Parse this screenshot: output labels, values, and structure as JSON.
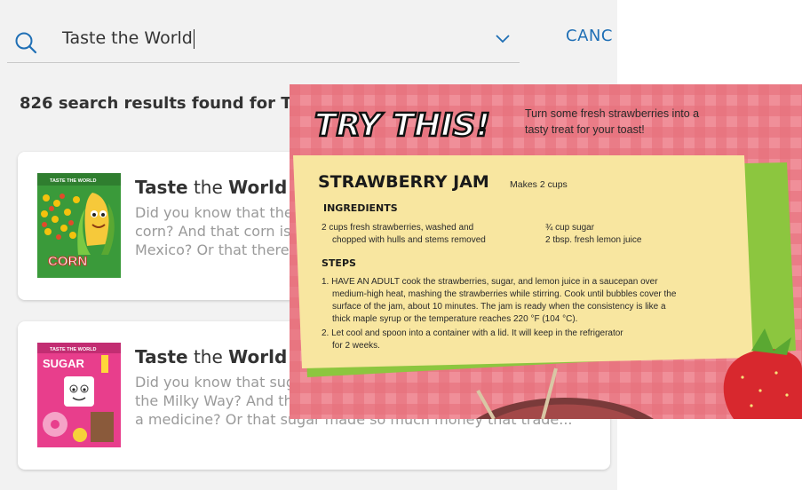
{
  "search": {
    "value": "Taste the World",
    "cancel_label": "CANC"
  },
  "results": {
    "count_text": "826 search results found for T"
  },
  "cards": [
    {
      "title_bold_1": "Taste",
      "title_plain": " the ",
      "title_bold_2": "World",
      "desc_lines": [
        "Did you know that the",
        "corn? And that corn is",
        "Mexico? Or that there"
      ],
      "cover_series": "TASTE THE WORLD",
      "cover_word": "CORN"
    },
    {
      "title_bold_1": "Taste",
      "title_plain": " the ",
      "title_bold_2": "World",
      "desc_lines": [
        "Did you know that sug",
        "the Milky Way? And th",
        "a medicine? Or that sugar made so much money that trade..."
      ],
      "cover_series": "TASTE THE WORLD",
      "cover_word": "SUGAR"
    }
  ],
  "recipe": {
    "banner": "TRY THIS!",
    "intro_line1": "Turn some fresh strawberries into a",
    "intro_line2": "tasty treat for your toast!",
    "title": "STRAWBERRY JAM",
    "makes": "Makes 2 cups",
    "ingredients_heading": "INGREDIENTS",
    "ingredient_1_line1": "2 cups fresh strawberries, washed and",
    "ingredient_1_line2": "chopped with hulls and stems removed",
    "ingredient_2": "¾ cup sugar",
    "ingredient_3": "2 tbsp. fresh lemon juice",
    "steps_heading": "STEPS",
    "step_lines": [
      "1. HAVE AN ADULT cook the strawberries, sugar, and lemon juice in a saucepan over",
      "medium-high heat, mashing the strawberries while stirring. Cook until bubbles cover the",
      "surface of the jam, about 10 minutes. The jam is ready when the consistency is like a",
      "thick maple syrup or the temperature reaches 220 °F (104 °C).",
      "2. Let cool and spoon into a container with a lid. It will keep in the refrigerator",
      "for 2 weeks."
    ]
  },
  "colors": {
    "link": "#1f6fb5",
    "recipe_pink": "#e8707c",
    "recipe_card": "#f8e6a0",
    "recipe_green": "#8cc63f"
  }
}
